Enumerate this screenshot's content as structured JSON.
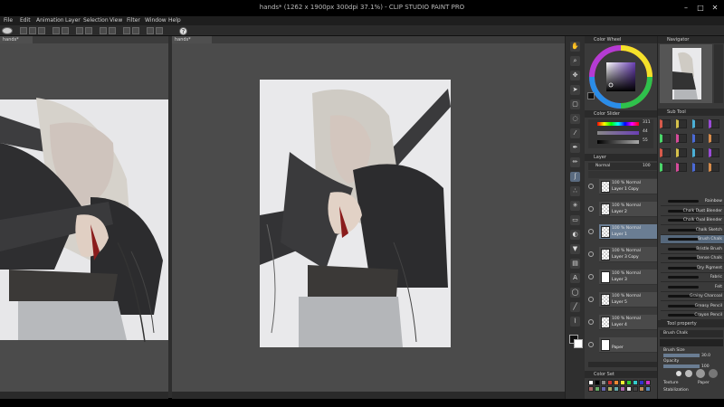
{
  "window": {
    "title": "hands* (1262 x 1900px 300dpi 37.1%) - CLIP STUDIO PAINT PRO",
    "min": "–",
    "max": "□",
    "close": "✕"
  },
  "menu": [
    "File",
    "Edit",
    "Animation",
    "Layer",
    "Selection",
    "View",
    "Filter",
    "Window",
    "Help"
  ],
  "canvas_tabs": [
    {
      "label": "hands*"
    },
    {
      "label": "hands*"
    }
  ],
  "tools_icons": [
    "hand-icon",
    "zoom-icon",
    "move-icon",
    "operation-icon",
    "selection-icon",
    "lasso-icon",
    "eyedropper-icon",
    "pen-icon",
    "pencil-icon",
    "brush-icon",
    "airbrush-icon",
    "decoration-icon",
    "eraser-icon",
    "blend-icon",
    "fill-icon",
    "gradient-icon",
    "figure-icon",
    "text-icon",
    "balloon-icon",
    "ruler-icon",
    "correct-line-icon",
    "color-swatch-icon"
  ],
  "panels": {
    "color_wheel": {
      "title": "Color Wheel",
      "hue_color": "#6a3fb5"
    },
    "color_slider": {
      "title": "Color Slider",
      "values": [
        "311",
        "44",
        "55"
      ]
    },
    "layer": {
      "title": "Layer",
      "blend_mode": "Normal",
      "opacity": "100",
      "rows": [
        {
          "mode": "100 % Normal",
          "name": "Layer 1 Copy",
          "checker": true,
          "selected": false
        },
        {
          "mode": "100 % Normal",
          "name": "Layer 2",
          "checker": true,
          "selected": false
        },
        {
          "mode": "100 % Normal",
          "name": "Layer 1",
          "checker": true,
          "selected": true
        },
        {
          "mode": "100 % Normal",
          "name": "Layer 3 Copy",
          "checker": true,
          "selected": false
        },
        {
          "mode": "100 % Normal",
          "name": "Layer 3",
          "checker": false,
          "selected": false
        },
        {
          "mode": "100 % Normal",
          "name": "Layer 5",
          "checker": true,
          "selected": false
        },
        {
          "mode": "100 % Normal",
          "name": "Layer 4",
          "checker": true,
          "selected": false
        },
        {
          "mode": "",
          "name": "Paper",
          "checker": false,
          "selected": false
        }
      ]
    },
    "navigator": {
      "title": "Navigator"
    },
    "sub_tool": {
      "title": "Sub Tool",
      "groups": [
        "Pen",
        "Pencil",
        "Fude",
        "Watercolor",
        "Oil Paint",
        "Real pencil",
        "Ink",
        "Airbrush",
        "Thick paint",
        "Decor",
        "Chalk",
        "Dry",
        "Paint",
        "Texture",
        "Pastel",
        "Realistic"
      ]
    },
    "brushes": [
      {
        "name": "Rainbow"
      },
      {
        "name": "Chalk Dust Blender"
      },
      {
        "name": "Chalk Oval Blender"
      },
      {
        "name": "Chalk Sketch"
      },
      {
        "name": "Brush Chalk"
      },
      {
        "name": "Bristle Brush"
      },
      {
        "name": "Dense Chalk"
      },
      {
        "name": "Dry Pigment"
      },
      {
        "name": "Fabric"
      },
      {
        "name": "Felt"
      },
      {
        "name": "Grainy Charcoal"
      },
      {
        "name": "Greasy Pencil"
      },
      {
        "name": "Crayon Pencil"
      }
    ],
    "tool_property": {
      "title": "Tool property",
      "brush": "Brush Chalk",
      "brush_size_label": "Brush Size",
      "brush_size": "30.0",
      "opacity_label": "Opacity",
      "opacity": "100",
      "texture_label": "Texture",
      "texture_value": "Paper",
      "stabilization_label": "Stabilization"
    },
    "color_set": {
      "title": "Color Set"
    }
  },
  "colors": {
    "accent": "#6a7d93",
    "canvas_bg": "#4b4b4b",
    "panel_bg": "#3a3a3a"
  }
}
